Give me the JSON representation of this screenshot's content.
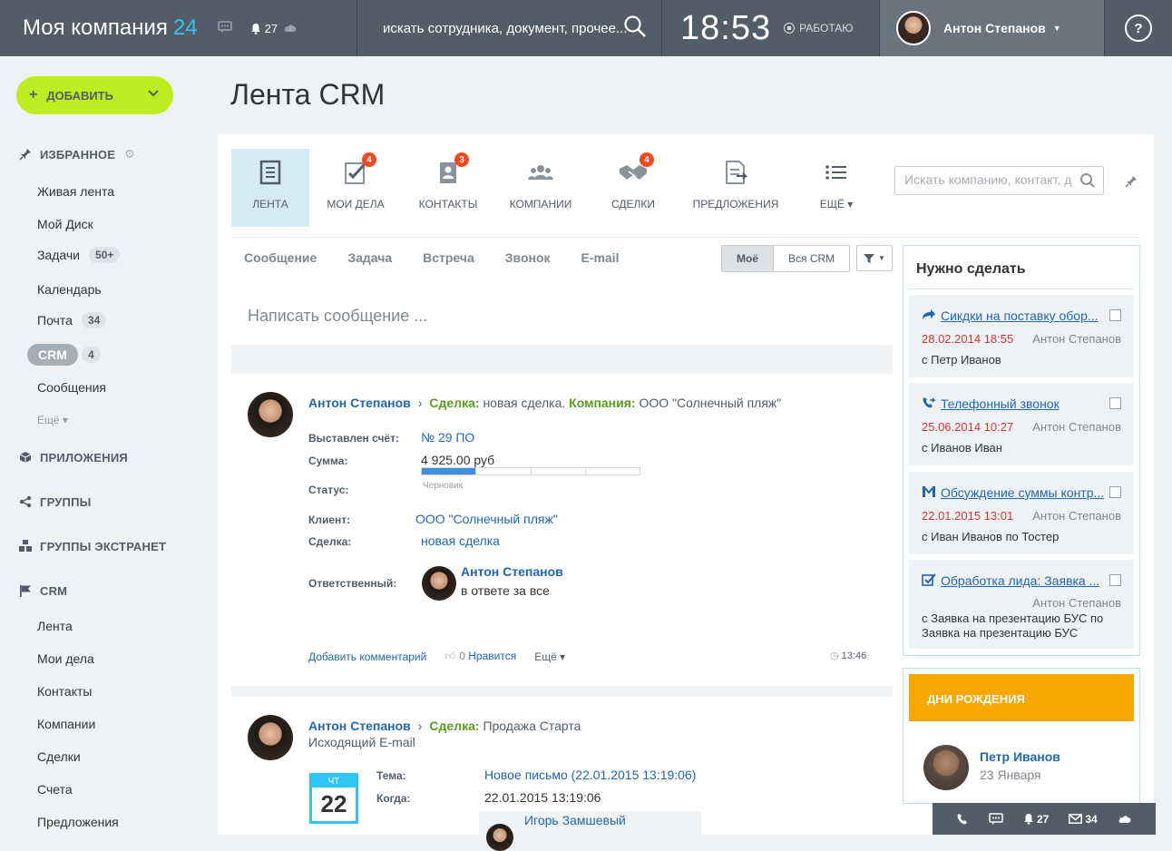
{
  "topbar": {
    "company": "Моя компания",
    "company_num": "24",
    "notif_count": "27",
    "search_placeholder": "искать сотрудника, документ, прочее...",
    "time": "18:53",
    "work_status": "РАБОТАЮ",
    "user_name": "Антон Степанов",
    "help": "?"
  },
  "sidebar": {
    "add_label": "ДОБАВИТЬ",
    "favorites": "ИЗБРАННОЕ",
    "items": [
      {
        "label": "Живая лента"
      },
      {
        "label": "Мой Диск"
      },
      {
        "label": "Задачи",
        "badge": "50+"
      },
      {
        "label": "Календарь"
      },
      {
        "label": "Почта",
        "badge": "34"
      },
      {
        "label": "CRM",
        "badge": "4"
      },
      {
        "label": "Сообщения"
      }
    ],
    "more": "Ещё",
    "apps": "ПРИЛОЖЕНИЯ",
    "groups": "ГРУППЫ",
    "extranet": "ГРУППЫ ЭКСТРАНЕТ",
    "crm": "CRM",
    "crm_items": [
      "Лента",
      "Мои дела",
      "Контакты",
      "Компании",
      "Сделки",
      "Счета",
      "Предложения"
    ]
  },
  "page_title": "Лента CRM",
  "tabs": [
    {
      "label": "ЛЕНТА",
      "count": ""
    },
    {
      "label": "МОИ ДЕЛА",
      "count": "4"
    },
    {
      "label": "КОНТАКТЫ",
      "count": "3"
    },
    {
      "label": "КОМПАНИИ",
      "count": ""
    },
    {
      "label": "СДЕЛКИ",
      "count": "4"
    },
    {
      "label": "ПРЕДЛОЖЕНИЯ",
      "count": ""
    },
    {
      "label": "ЕЩЁ",
      "count": ""
    }
  ],
  "tab_search_placeholder": "Искать компанию, контакт, д",
  "feed_tabs": [
    "Сообщение",
    "Задача",
    "Встреча",
    "Звонок",
    "E-mail"
  ],
  "scope": {
    "mine": "Моё",
    "all": "Вся CRM"
  },
  "compose_placeholder": "Написать сообщение ...",
  "post1": {
    "author": "Антон Степанов",
    "deal_label": "Сделка:",
    "deal_value": "новая сделка.",
    "company_label": "Компания:",
    "company_value": "ООО \"Солнечный пляж\"",
    "invoice_label": "Выставлен счёт:",
    "invoice_value": "№ 29 ПО",
    "sum_label": "Сумма:",
    "sum_value": "4 925.00 руб",
    "status_label": "Статус:",
    "status_value": "Черновик",
    "status_progress": 0.25,
    "client_label": "Клиент:",
    "client_value": "ООО \"Солнечный пляж\"",
    "deal2_label": "Сделка:",
    "deal2_value": "новая сделка",
    "resp_label": "Ответственный:",
    "resp_name": "Антон Степанов",
    "resp_sub": "в ответе за все",
    "add_comment": "Добавить комментарий",
    "likes": "0",
    "like_label": "Нравится",
    "more": "Ещё",
    "time": "13:46"
  },
  "post2": {
    "author": "Антон Степанов",
    "deal_label": "Сделка:",
    "deal_value": "Продажа Старта",
    "sub": "Исходящий E-mail",
    "cal_day": "ЧТ",
    "cal_num": "22",
    "subject_label": "Тема:",
    "subject_value": "Новое письмо (22.01.2015 13:19:06)",
    "when_label": "Когда:",
    "when_value": "22.01.2015 13:19:06",
    "contact_name": "Игорь Замшевый"
  },
  "todo": {
    "title": "Нужно сделать",
    "items": [
      {
        "title": "Сикдки на поставку обор...",
        "date": "28.02.2014 18:55",
        "who": "Антон Степанов",
        "with": "с Петр Иванов"
      },
      {
        "title": "Телефонный звонок",
        "date": "25.06.2014 10:27",
        "who": "Антон Степанов",
        "with": "с Иванов Иван"
      },
      {
        "title": "Обсуждение суммы контр...",
        "date": "22.01.2015 13:01",
        "who": "Антон Степанов",
        "with": "с Иван Иванов по Тостер"
      },
      {
        "title": "Обработка лида: Заявка ...",
        "date": "",
        "who": "Антон Степанов",
        "with": "с Заявка на презентацию БУС по Заявка на презентацию БУС"
      }
    ]
  },
  "birthdays": {
    "title": "ДНИ РОЖДЕНИЯ",
    "name": "Петр Иванов",
    "date": "23 Января"
  },
  "bottom": {
    "notif": "27",
    "mail": "34"
  }
}
